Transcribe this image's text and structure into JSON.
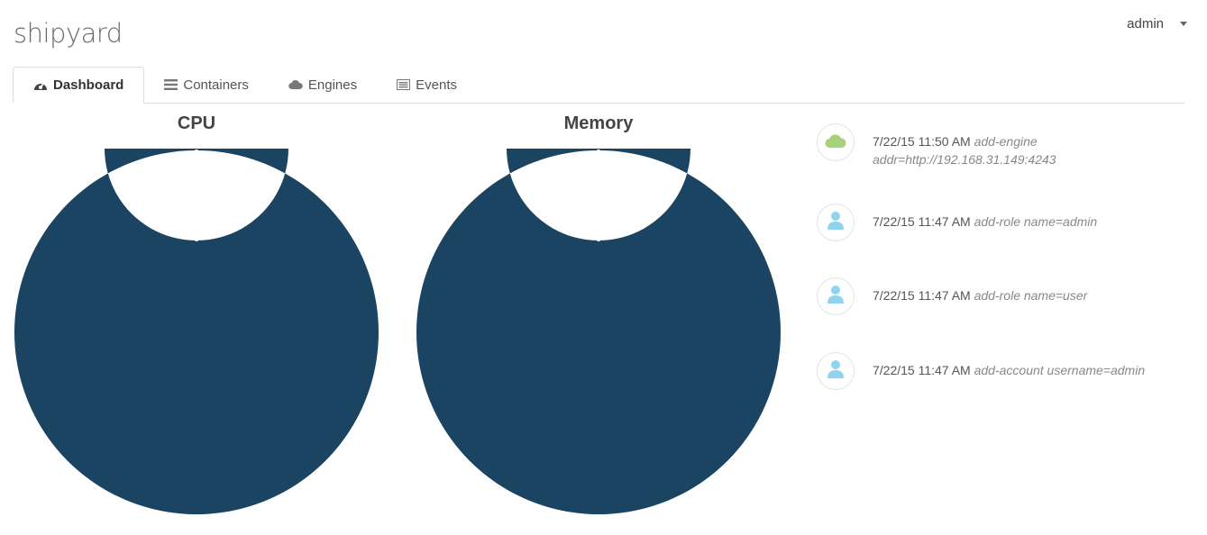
{
  "app": {
    "logo": "shipyard"
  },
  "user_menu": {
    "label": "admin"
  },
  "tabs": [
    {
      "label": "Dashboard",
      "icon": "dashboard-icon",
      "active": true
    },
    {
      "label": "Containers",
      "icon": "list-icon",
      "active": false
    },
    {
      "label": "Engines",
      "icon": "cloud-icon",
      "active": false
    },
    {
      "label": "Events",
      "icon": "event-list-icon",
      "active": false
    }
  ],
  "charts": {
    "cpu_title": "CPU",
    "memory_title": "Memory"
  },
  "chart_data": [
    {
      "type": "pie",
      "title": "CPU",
      "values": [
        100
      ],
      "colors": [
        "#1b4462"
      ],
      "donut": true
    },
    {
      "type": "pie",
      "title": "Memory",
      "values": [
        100
      ],
      "colors": [
        "#1b4462"
      ],
      "donut": true
    }
  ],
  "events": [
    {
      "time": "7/22/15 11:50 AM",
      "message": "add-engine",
      "message_line2": "addr=http://192.168.31.149:4243",
      "icon": "cloud-icon",
      "icon_color": "#a7d17a"
    },
    {
      "time": "7/22/15 11:47 AM",
      "message": "add-role name=admin",
      "icon": "user-icon",
      "icon_color": "#8fd3ef"
    },
    {
      "time": "7/22/15 11:47 AM",
      "message": "add-role name=user",
      "icon": "user-icon",
      "icon_color": "#8fd3ef"
    },
    {
      "time": "7/22/15 11:47 AM",
      "message": "add-account username=admin",
      "icon": "user-icon",
      "icon_color": "#8fd3ef"
    }
  ]
}
